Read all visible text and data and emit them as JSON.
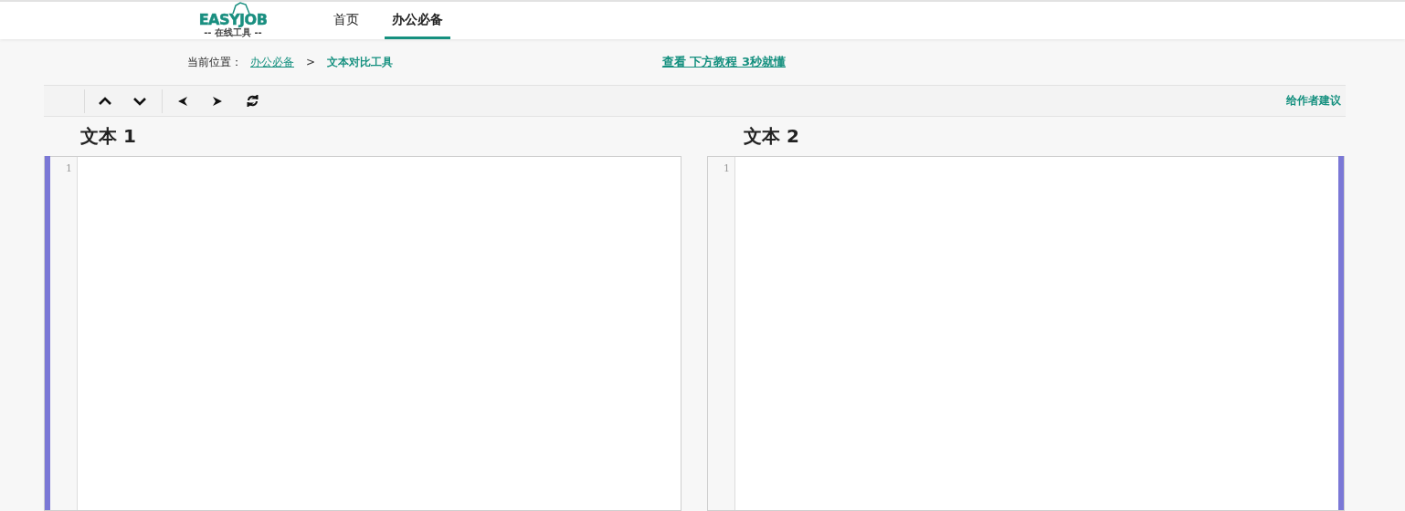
{
  "logo": {
    "title": "EASYJOB",
    "subtitle": "-- 在线工具 --"
  },
  "nav": [
    {
      "label": "首页",
      "selected": false
    },
    {
      "label": "办公必备",
      "selected": true
    }
  ],
  "breadcrumb": {
    "prefix": "当前位置：",
    "items": [
      {
        "label": "办公必备",
        "kind": "link"
      },
      {
        "label": ">",
        "kind": "separator"
      },
      {
        "label": "文本对比工具",
        "kind": "current"
      }
    ]
  },
  "tutorial_link": "查看 下方教程 3秒就懂",
  "toolbar": {
    "buttons": [
      {
        "kind": "up"
      },
      {
        "kind": "down"
      },
      {
        "kind": "left"
      },
      {
        "kind": "right"
      },
      {
        "kind": "swap"
      }
    ],
    "feedback": "给作者建议"
  },
  "editors": [
    {
      "title": "文本 1",
      "line_numbers": [
        "1"
      ]
    },
    {
      "title": "文本 2",
      "line_numbers": [
        "1"
      ]
    }
  ]
}
